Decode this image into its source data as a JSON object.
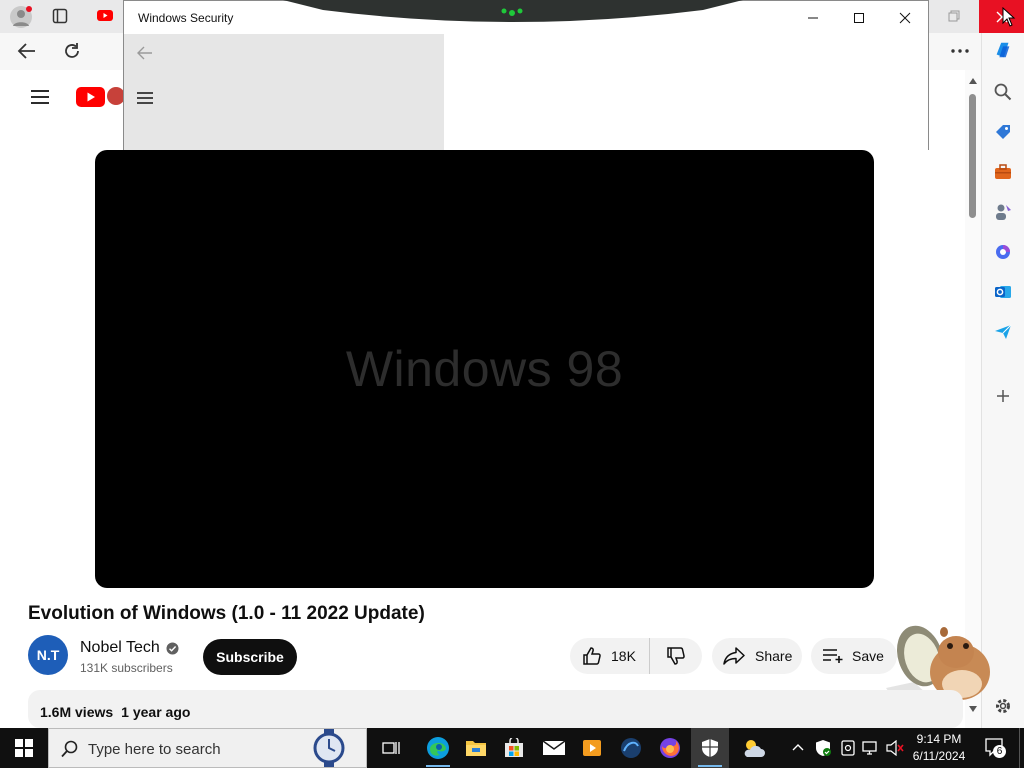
{
  "security_window": {
    "title": "Windows Security",
    "minimize_icon": "minimize-icon",
    "maximize_icon": "maximize-icon",
    "close_icon": "close-icon"
  },
  "video": {
    "overlay_text": "Windows 98",
    "title": "Evolution of Windows (1.0 - 11 2022 Update)"
  },
  "channel": {
    "avatar_text": "N.T",
    "name": "Nobel Tech",
    "subscribers": "131K subscribers",
    "subscribe_label": "Subscribe"
  },
  "actions": {
    "likes": "18K",
    "share_label": "Share",
    "save_label": "Save"
  },
  "description": {
    "views": "1.6M views",
    "age": "1 year ago"
  },
  "taskbar": {
    "search_placeholder": "Type here to search",
    "time": "9:14 PM",
    "date": "6/11/2024",
    "notification_count": "6"
  },
  "colors": {
    "youtube_red": "#ff0000",
    "subscribe_bg": "#0f0f0f",
    "taskbar_bg": "#101010",
    "avatar_bg": "#1e5eb8"
  }
}
